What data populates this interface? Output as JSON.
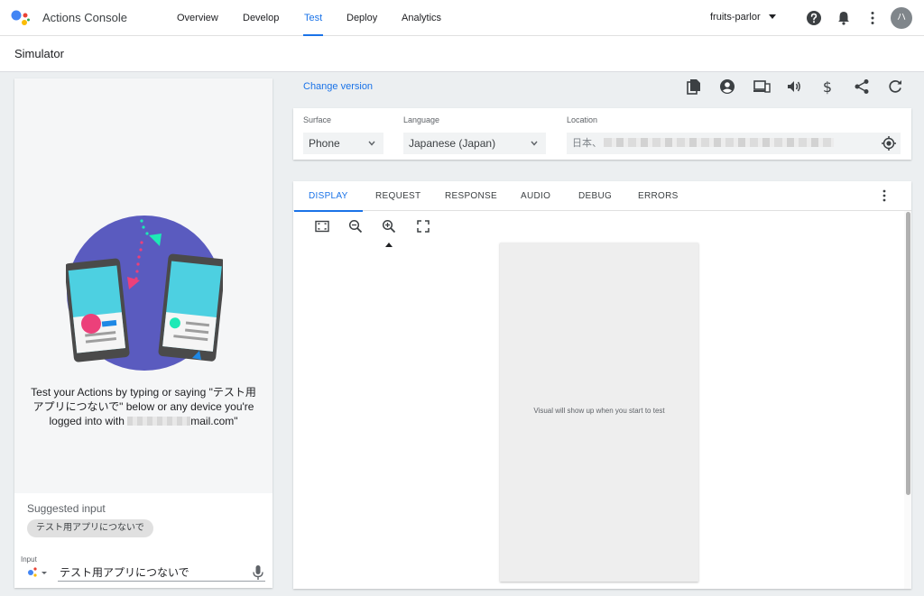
{
  "app": {
    "brand": "Actions Console"
  },
  "nav": [
    {
      "label": "Overview"
    },
    {
      "label": "Develop"
    },
    {
      "label": "Test",
      "active": true
    },
    {
      "label": "Deploy"
    },
    {
      "label": "Analytics"
    }
  ],
  "project": {
    "name": "fruits-parlor"
  },
  "user": {
    "avatar_text": "ハ"
  },
  "page": {
    "title": "Simulator"
  },
  "simulator": {
    "intro_line1": "Test your Actions by typing or saying \"テスト用",
    "intro_line2": "アプリにつないで\" below or any device you're",
    "intro_line3_prefix": "logged into with ",
    "intro_line3_suffix": "mail.com\"",
    "suggested_label": "Suggested input",
    "suggestion_chip": "テスト用アプリにつないで",
    "input_label": "Input",
    "input_value": "テスト用アプリにつないで"
  },
  "toolbar": {
    "change_version": "Change version"
  },
  "settings": {
    "surface_label": "Surface",
    "surface_value": "Phone",
    "language_label": "Language",
    "language_value": "Japanese (Japan)",
    "location_label": "Location",
    "location_value": "日本、"
  },
  "tabs": [
    {
      "label": "DISPLAY",
      "active": true
    },
    {
      "label": "REQUEST"
    },
    {
      "label": "RESPONSE"
    },
    {
      "label": "AUDIO"
    },
    {
      "label": "DEBUG"
    },
    {
      "label": "ERRORS"
    }
  ],
  "display": {
    "placeholder": "Visual will show up when you start to test"
  },
  "colors": {
    "accent": "#1a73e8",
    "panel": "#f5f6f7",
    "background": "#eceff1"
  },
  "icons": {
    "topbar": [
      "help-icon",
      "bell-icon",
      "more-vert-icon"
    ],
    "tools": [
      "copy-icon",
      "account-icon",
      "devices-icon",
      "volume-icon",
      "dollar-icon",
      "share-icon",
      "refresh-icon"
    ],
    "view": [
      "fit-screen-icon",
      "zoom-out-icon",
      "zoom-in-icon",
      "fullscreen-icon"
    ]
  }
}
